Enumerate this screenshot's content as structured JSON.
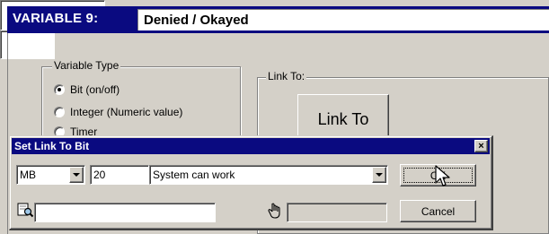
{
  "variable": {
    "label": "VARIABLE 9:",
    "name": "Denied / Okayed"
  },
  "variable_type": {
    "title": "Variable Type",
    "options": [
      {
        "label": "Bit (on/off)",
        "checked": true
      },
      {
        "label": "Integer (Numeric value)",
        "checked": false
      },
      {
        "label": "Timer",
        "checked": false
      }
    ]
  },
  "link_to": {
    "title": "Link To:",
    "button_label": "Link To",
    "value": ""
  },
  "dialog": {
    "title": "Set Link To Bit",
    "close_label": "×",
    "area_value": "MB",
    "address_value": "20",
    "description_value": "System can work",
    "search_value": "",
    "readonly_value": "",
    "ok_label": "OK",
    "cancel_label": "Cancel"
  }
}
